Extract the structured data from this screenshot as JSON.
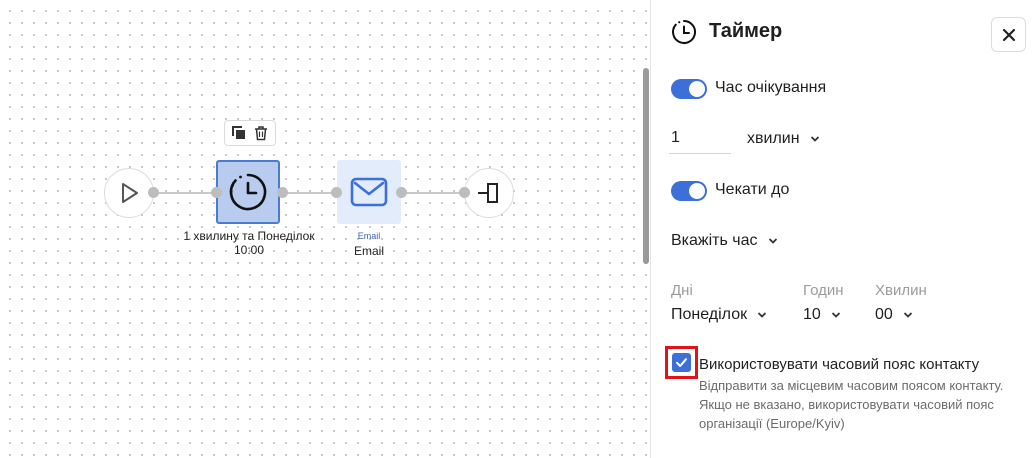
{
  "canvas": {
    "timer_node": {
      "label_line1": "1 хвилину та Понеділок",
      "label_line2": "10:00"
    },
    "email_node": {
      "sublabel": "Email",
      "label": "Email"
    }
  },
  "panel": {
    "title": "Таймер",
    "wait_toggle": {
      "label": "Час очікування",
      "checked": true
    },
    "wait_amount": {
      "value": "1"
    },
    "wait_unit": {
      "selected": "хвилин"
    },
    "until_toggle": {
      "label": "Чекати до",
      "checked": true
    },
    "time_mode": {
      "selected": "Вкажіть час"
    },
    "schedule": {
      "days_label": "Дні",
      "days_value": "Понеділок",
      "hours_label": "Годин",
      "hours_value": "10",
      "minutes_label": "Хвилин",
      "minutes_value": "00"
    },
    "timezone": {
      "label": "Використовувати часовий пояс контакту",
      "checked": true,
      "description": "Відправити за місцевим часовим поясом контакту. Якщо не вказано, використовувати часовий пояс організації (Europe/Kyiv)"
    }
  },
  "colors": {
    "accent": "#3d6fd9",
    "highlight_frame": "#e0131b",
    "selected_node_fill": "#b9cbee",
    "email_node_fill": "#e2ecfb"
  },
  "icons": [
    "play-icon",
    "timer-icon",
    "copy-icon",
    "trash-icon",
    "envelope-icon",
    "exit-icon",
    "clock-icon",
    "close-icon",
    "chevron-down-icon",
    "check-icon"
  ]
}
